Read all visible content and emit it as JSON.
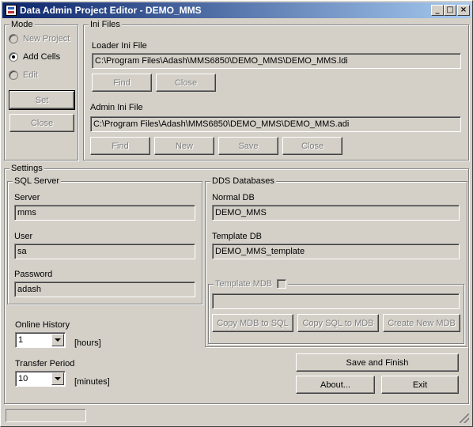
{
  "window": {
    "title": "Data Admin Project Editor - DEMO_MMS",
    "controls": {
      "minimize": "_",
      "maximize": "□",
      "close": "×"
    }
  },
  "mode": {
    "label": "Mode",
    "options": [
      {
        "label": "New Project",
        "checked": false,
        "enabled": false
      },
      {
        "label": "Add Cells",
        "checked": true,
        "enabled": true
      },
      {
        "label": "Edit",
        "checked": false,
        "enabled": false
      }
    ],
    "set_label": "Set",
    "close_label": "Close"
  },
  "ini_files": {
    "label": "Ini Files",
    "loader": {
      "label": "Loader Ini File",
      "value": "C:\\Program Files\\Adash\\MMS6850\\DEMO_MMS\\DEMO_MMS.ldi",
      "find_label": "Find",
      "close_label": "Close"
    },
    "admin": {
      "label": "Admin Ini File",
      "value": "C:\\Program Files\\Adash\\MMS6850\\DEMO_MMS\\DEMO_MMS.adi",
      "find_label": "Find",
      "new_label": "New",
      "save_label": "Save",
      "close_label": "Close"
    }
  },
  "settings": {
    "label": "Settings",
    "sql_server": {
      "label": "SQL Server",
      "server_label": "Server",
      "server_value": "mms",
      "user_label": "User",
      "user_value": "sa",
      "password_label": "Password",
      "password_value": "adash"
    },
    "dds": {
      "label": "DDS Databases",
      "normal_label": "Normal DB",
      "normal_value": "DEMO_MMS",
      "template_label": "Template DB",
      "template_value": "DEMO_MMS_template",
      "mdb": {
        "label": "Template MDB",
        "value": "",
        "copy_mdb_to_sql": "Copy MDB to SQL",
        "copy_sql_to_mdb": "Copy SQL to MDB",
        "create_new_mdb": "Create New MDB"
      }
    },
    "online_history": {
      "label": "Online History",
      "value": "1",
      "unit": "[hours]"
    },
    "transfer_period": {
      "label": "Transfer Period",
      "value": "10",
      "unit": "[minutes]"
    }
  },
  "actions": {
    "save_finish": "Save and Finish",
    "about": "About...",
    "exit": "Exit"
  },
  "status": {
    "text": ""
  }
}
